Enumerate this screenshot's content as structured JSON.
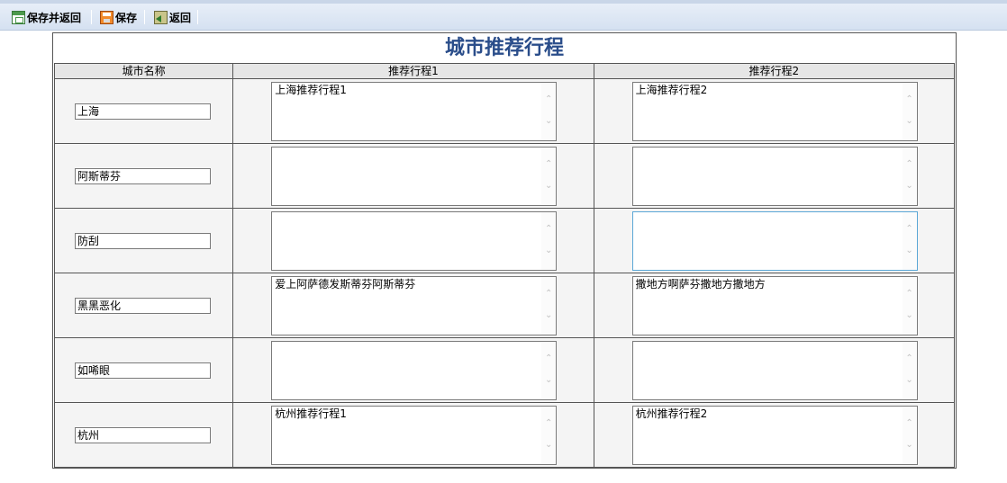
{
  "toolbar": {
    "save_return_label": "保存并返回",
    "save_label": "保存",
    "back_label": "返回"
  },
  "page": {
    "title": "城市推荐行程"
  },
  "table": {
    "headers": [
      "城市名称",
      "推荐行程1",
      "推荐行程2"
    ],
    "rows": [
      {
        "city": "上海",
        "itinerary1": "上海推荐行程1",
        "itinerary2": "上海推荐行程2"
      },
      {
        "city": "阿斯蒂芬",
        "itinerary1": "",
        "itinerary2": ""
      },
      {
        "city": "防刮",
        "itinerary1": "",
        "itinerary2": ""
      },
      {
        "city": "黑黑恶化",
        "itinerary1": "爱上阿萨德发斯蒂芬阿斯蒂芬",
        "itinerary2": "撒地方啊萨芬撒地方撒地方"
      },
      {
        "city": "如唏眼",
        "itinerary1": "",
        "itinerary2": ""
      },
      {
        "city": "杭州",
        "itinerary1": "杭州推荐行程1",
        "itinerary2": "杭州推荐行程2"
      }
    ]
  }
}
